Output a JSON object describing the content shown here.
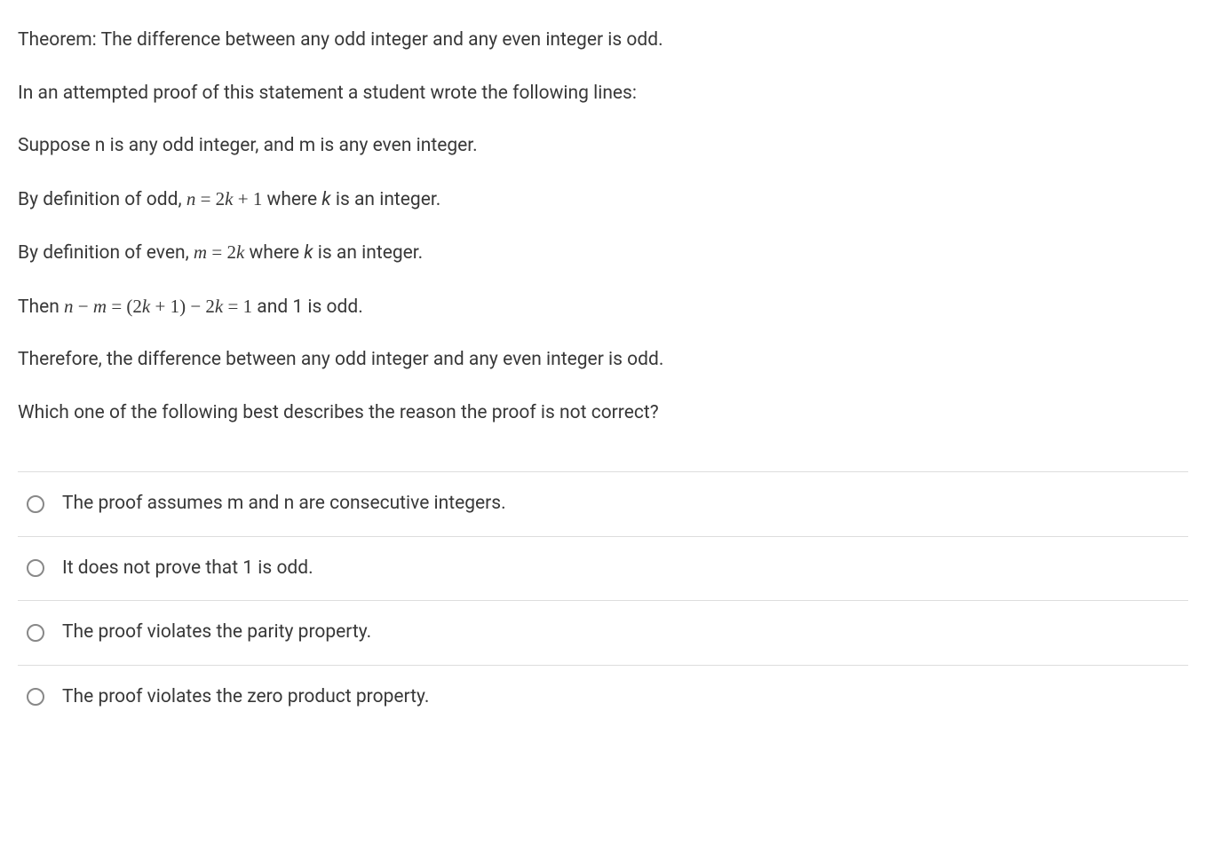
{
  "question": {
    "p1": "Theorem: The difference between any odd integer and any even integer is odd.",
    "p2": "In an attempted proof of this statement a student wrote the following lines:",
    "p3": "Suppose n is any odd integer, and m is any even integer.",
    "p4_pre": "By definition of odd, ",
    "p4_math_lhs": "n",
    "p4_math_eq": " = ",
    "p4_math_rhs": "2k + 1",
    "p4_post": " where k is an integer.",
    "p5_pre": "By definition of even, ",
    "p5_math_lhs": "m",
    "p5_math_eq": " = ",
    "p5_math_rhs": "2k",
    "p5_post": " where k is an integer.",
    "p6_pre": "Then ",
    "p6_math": "n − m = (2k + 1) − 2k = 1",
    "p6_post": " and 1 is odd.",
    "p7": "Therefore, the difference between any odd integer and any even integer is odd.",
    "p8": "Which one of the following best describes the reason the proof is not correct?"
  },
  "options": {
    "a": "The proof assumes m and n are consecutive integers.",
    "b": "It does not prove that 1 is odd.",
    "c": "The proof violates the parity property.",
    "d": "The proof violates the zero product property."
  }
}
